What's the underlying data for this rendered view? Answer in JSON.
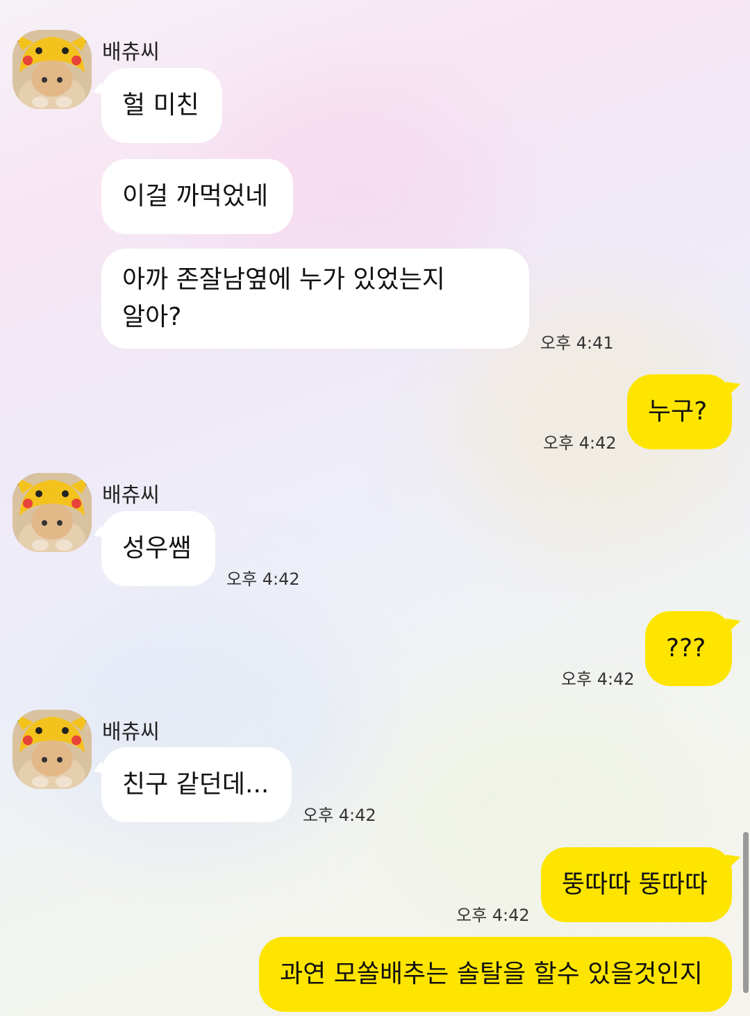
{
  "chat": {
    "friend_name": "배츄씨",
    "messages": [
      {
        "from": "friend",
        "text": "헐 미친"
      },
      {
        "from": "friend",
        "text": "이걸 까먹었네"
      },
      {
        "from": "friend",
        "text_line1": "아까 존잘남옆에 누가 있었는지",
        "text_line2": "알아?",
        "time": "오후 4:41"
      },
      {
        "from": "me",
        "text": "누구?",
        "time": "오후 4:42"
      },
      {
        "from": "friend",
        "text": "성우쌤",
        "time": "오후 4:42"
      },
      {
        "from": "me",
        "text": "???",
        "time": "오후 4:42"
      },
      {
        "from": "friend",
        "text": "친구 같던데...",
        "time": "오후 4:42"
      },
      {
        "from": "me",
        "text": "뚱따따 뚱따따",
        "time": "오후 4:42"
      },
      {
        "from": "me",
        "text": "과연 모쏠배추는 솔탈을 할수 있을것인지"
      }
    ]
  },
  "colors": {
    "my_bubble": "#fee500",
    "friend_bubble": "#ffffff"
  },
  "icons": {
    "avatar": "pikachu-hat-cat-avatar"
  }
}
